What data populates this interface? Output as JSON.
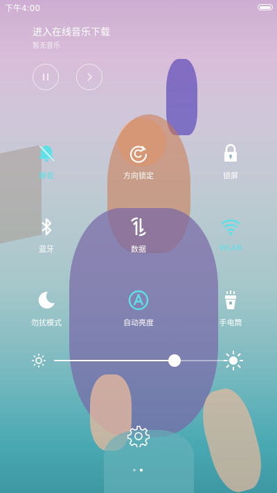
{
  "status_bar": {
    "time": "下午4:00"
  },
  "music": {
    "title": "进入在线音乐下载",
    "subtitle": "暂无音乐"
  },
  "tiles": [
    {
      "label": "静音",
      "icon": "bell-muted-icon",
      "active": true
    },
    {
      "label": "方向锁定",
      "icon": "rotation-lock-icon",
      "active": false
    },
    {
      "label": "锁屏",
      "icon": "lock-icon",
      "active": false
    },
    {
      "label": "蓝牙",
      "icon": "bluetooth-icon",
      "active": false
    },
    {
      "label": "数据",
      "icon": "mobile-data-icon",
      "active": false
    },
    {
      "label": "WLAN",
      "icon": "wifi-icon",
      "active": true
    },
    {
      "label": "勿扰模式",
      "icon": "moon-icon",
      "active": false
    },
    {
      "label": "自动亮度",
      "icon": "auto-brightness-icon",
      "active": false
    },
    {
      "label": "手电筒",
      "icon": "flashlight-icon",
      "active": false
    }
  ],
  "brightness": {
    "level": 0.69
  },
  "pager": {
    "pages": 2,
    "current": 1
  },
  "colors": {
    "accent": "#5de0e6",
    "icon": "#ffffff"
  }
}
